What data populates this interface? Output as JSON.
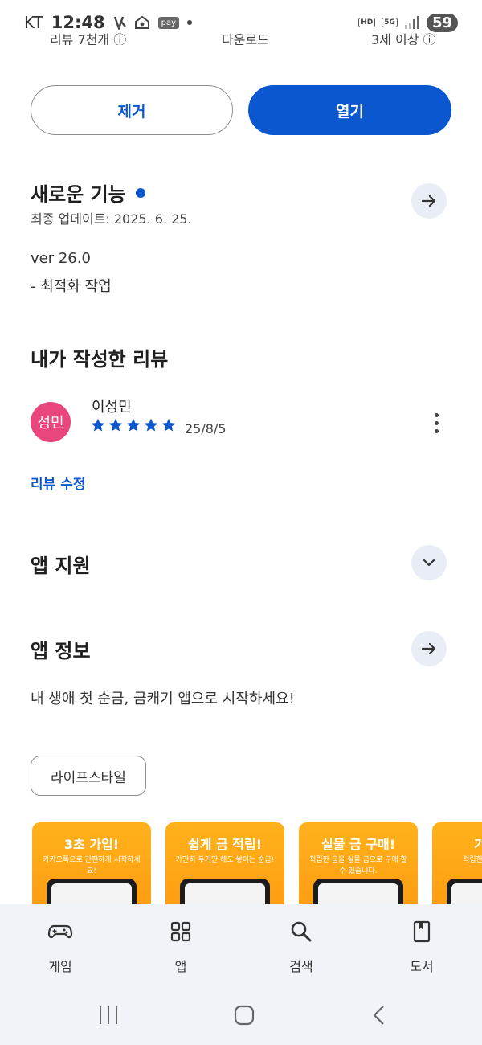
{
  "status_bar": {
    "carrier": "KT",
    "time": "12:48",
    "pay_label": "pay",
    "hd_label": "HD",
    "network_label": "5G",
    "battery": "59"
  },
  "stats_row": {
    "reviews": "리뷰 7천개 ⓘ",
    "downloads": "다운로드",
    "age_rating": "3세 이상 ⓘ"
  },
  "actions": {
    "remove_label": "제거",
    "open_label": "열기"
  },
  "whats_new": {
    "title": "새로운 기능",
    "last_updated": "최종 업데이트: 2025. 6. 25.",
    "version": "ver 26.0",
    "notes": "- 최적화 작업"
  },
  "my_review": {
    "title": "내가 작성한 리뷰",
    "avatar_text": "성민",
    "reviewer_name": "이성민",
    "rating": 5,
    "date": "25/8/5",
    "edit_label": "리뷰 수정"
  },
  "app_support": {
    "title": "앱 지원"
  },
  "app_info": {
    "title": "앱 정보",
    "description": "내 생애 첫 순금, 금캐기 앱으로 시작하세요!",
    "category": "라이프스타일"
  },
  "screenshots": [
    {
      "title": "3초 가입!",
      "subtitle": "카카오톡으로 간편하게 시작하세요!"
    },
    {
      "title": "쉽게 금 적립!",
      "subtitle": "가만히 두기만 해도 쌓이는 순금!"
    },
    {
      "title": "실물 금 구매!",
      "subtitle": "적립한 금을 실물 금으로 구매 할 수 있습니다."
    },
    {
      "title": "기프티",
      "subtitle": "적립한 금 기프티콘"
    }
  ],
  "bottom_nav": {
    "items": [
      {
        "label": "게임",
        "icon": "gamepad-icon"
      },
      {
        "label": "앱",
        "icon": "apps-grid-icon"
      },
      {
        "label": "검색",
        "icon": "search-icon"
      },
      {
        "label": "도서",
        "icon": "book-icon"
      }
    ]
  },
  "colors": {
    "accent": "#0b57d0",
    "avatar": "#e8467c",
    "screenshot_bg": "#ffa514",
    "nav_bg": "#f0f4f9"
  }
}
